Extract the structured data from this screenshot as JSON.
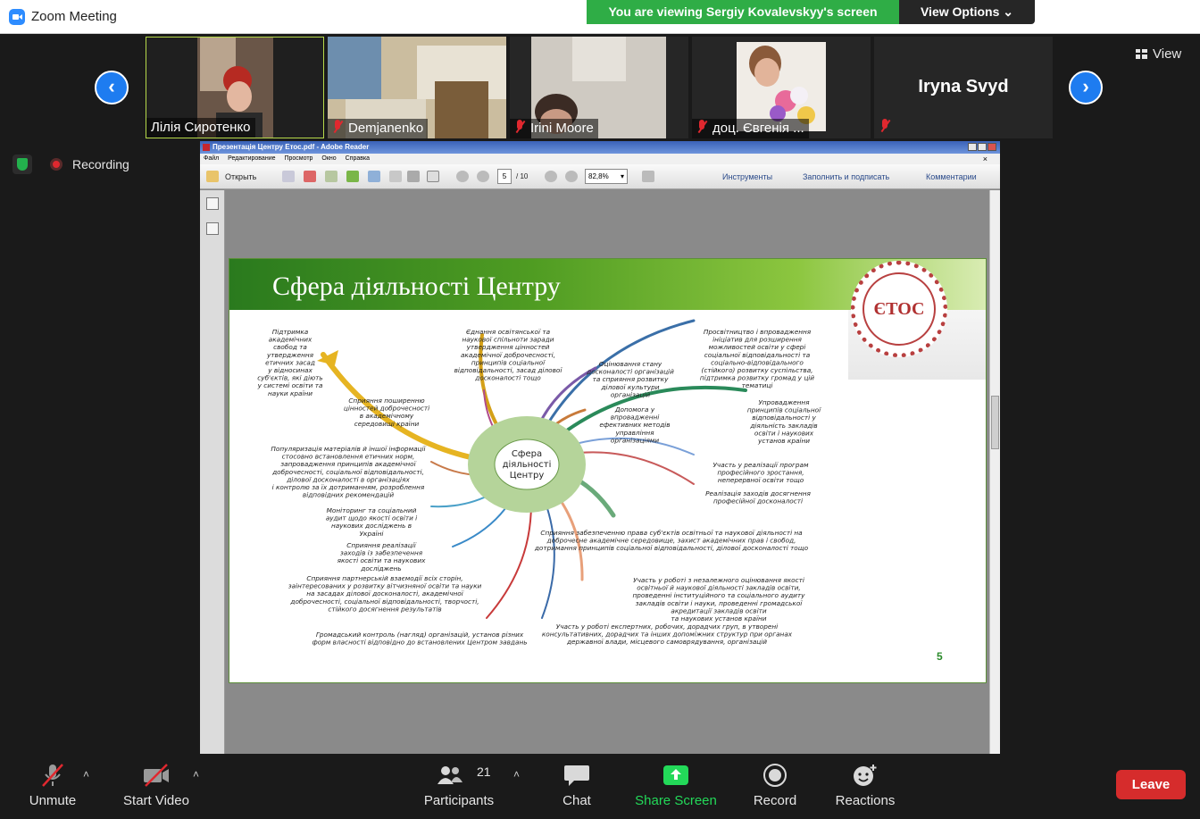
{
  "window": {
    "title": "Zoom Meeting"
  },
  "banner": {
    "viewing": "You are viewing Sergiy Kovalevskyy's screen",
    "view_options": "View Options ⌄"
  },
  "gallery": {
    "prev_icon": "‹",
    "next_icon": "›",
    "view_label": "View",
    "participants": [
      {
        "name": "Лілія Сиротенко",
        "muted": false
      },
      {
        "name": "Demjanenko",
        "muted": true
      },
      {
        "name": "Irini Moore",
        "muted": true
      },
      {
        "name": "доц. Євгенія ...",
        "muted": true
      },
      {
        "name": "Iryna Svyd",
        "muted": true
      }
    ]
  },
  "status": {
    "recording": "Recording"
  },
  "reader": {
    "window_title": "Презентація Центру Етос.pdf - Adobe Reader",
    "menu": [
      "Файл",
      "Редактирование",
      "Просмотр",
      "Окно",
      "Справка"
    ],
    "open_label": "Открыть",
    "page_current": "5",
    "page_total": "/ 10",
    "zoom": "82,8%",
    "tools_label": "Инструменты",
    "fill_sign_label": "Заполнить и подписать",
    "comments_label": "Комментарии"
  },
  "slide": {
    "title": "Сфера діяльності Центру",
    "seal_text": "ЄТОС",
    "page_number": "5",
    "center": [
      "Сфера",
      "діяльності",
      "Центру"
    ],
    "items": [
      [
        "Підтримка",
        "академічних",
        "свобод та",
        "утвердження",
        "етичних засад",
        "у відносинах",
        "суб'єктів, які діють",
        "у системі освіти та",
        "науки країни"
      ],
      [
        "Єднання освітянської та",
        "наукової спільноти заради",
        "утвердження цінностей",
        "академічної доброчесності,",
        "принципів соціальної",
        "відповідальності, засад ділової",
        "досконалості тощо"
      ],
      [
        "Просвітництво і впровадження",
        "ініціатив для розширення",
        "можливостей освіти у сфері",
        "соціальної відповідальності та",
        "соціально-відповідального",
        "(стійкого) розвитку суспільства,",
        "підтримка розвитку громад у цій",
        "тематиці"
      ],
      [
        "Оцінювання стану",
        "досконалості організацій",
        "та сприяння розвитку",
        "ділової культури",
        "організацій"
      ],
      [
        "Сприяння поширенню",
        "цінностей доброчесності",
        "в академічному",
        "середовищі країни"
      ],
      [
        "Допомога у",
        "впровадженні",
        "ефективних методів",
        "управління",
        "організаціями"
      ],
      [
        "Упровадження",
        "принципів соціальної",
        "відповідальності у",
        "діяльність закладів",
        "освіти і наукових",
        "установ країни"
      ],
      [
        "Популяризація матеріалів й іншої інформації",
        "стосовно встановлення етичних норм,",
        "запровадження принципів академічної",
        "доброчесності, соціальної відповідальності,",
        "ділової досконалості в організаціях",
        "і контролю за їх дотриманням, розроблення",
        "відповідних рекомендацій"
      ],
      [
        "Участь у реалізації програм",
        "професійного зростання,",
        "неперервної освіти тощо"
      ],
      [
        "Реалізація заходів досягнення",
        "професійної досконалості"
      ],
      [
        "Моніторинг та соціальний",
        "аудит щодо якості освіти і",
        "наукових досліджень в",
        "Україні"
      ],
      [
        "Сприяння забезпеченню права суб'єктів освітньої та наукової діяльності на",
        "доброчесне академічне середовище, захист академічних прав і свобод,",
        "дотримання принципів соціальної відповідальності, ділової досконалості тощо"
      ],
      [
        "Сприяння реалізації",
        "заходів із забезпечення",
        "якості освіти та наукових",
        "досліджень"
      ],
      [
        "Участь у роботі з незалежного оцінювання якості",
        "освітньої й наукової діяльності закладів освіти,",
        "проведенні інституційного та соціального аудиту",
        "закладів освіти і науки, проведенні громадської",
        "акредитації закладів освіти",
        "та наукових установ країни"
      ],
      [
        "Сприяння партнерській взаємодії всіх сторін,",
        "заінтересованих у розвитку вітчизняної освіти та науки",
        "на засадах ділової досконалості, академічної",
        "доброчесності, соціальної відповідальності, творчості,",
        "стійкого досягнення результатів"
      ],
      [
        "Громадський контроль (нагляд) організацій, установ різних",
        "форм власності відповідно до встановлених Центром завдань"
      ],
      [
        "Участь у роботі експертних, робочих, дорадчих груп, в утворені",
        "консультативних, дорадчих та інших допоміжних структур при органах",
        "державної влади, місцевого самоврядування, організацій"
      ]
    ]
  },
  "toolbar": {
    "unmute": "Unmute",
    "start_video": "Start Video",
    "participants": "Participants",
    "participants_count": "21",
    "chat": "Chat",
    "share_screen": "Share Screen",
    "record": "Record",
    "reactions": "Reactions",
    "leave": "Leave",
    "caret": "˄"
  },
  "colors": {
    "banner_green": "#2fad46",
    "share_green": "#23d959",
    "leave_red": "#d62c2c",
    "nav_blue": "#1e7cf0",
    "slide_green": "#4f9c22"
  }
}
